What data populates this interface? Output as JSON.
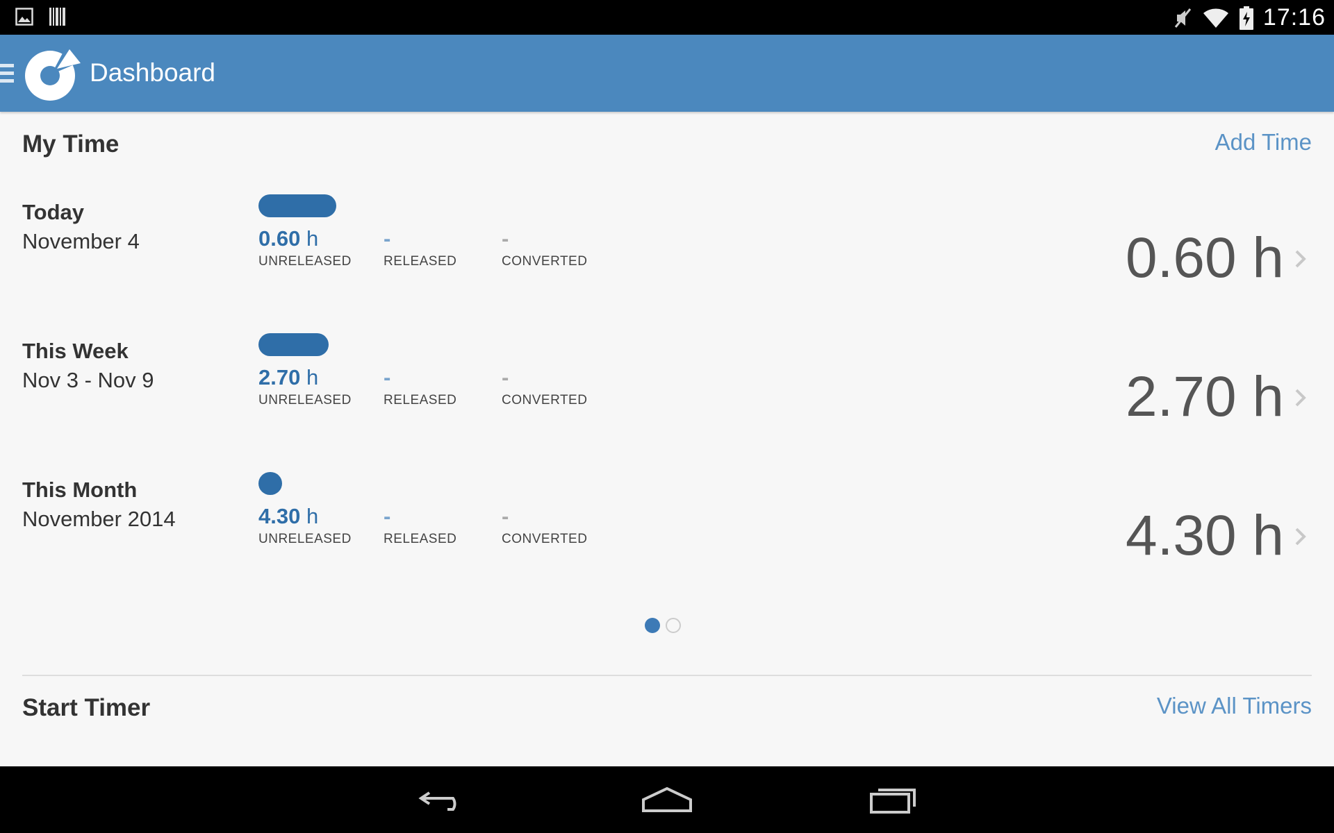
{
  "status_bar": {
    "time": "17:16",
    "left_icons": [
      "image-icon",
      "barcode-icon"
    ],
    "right_icons": [
      "mute-icon",
      "wifi-icon",
      "battery-icon"
    ]
  },
  "action_bar": {
    "title": "Dashboard",
    "menu_icon": "menu-icon",
    "logo": "app-logo"
  },
  "my_time": {
    "title": "My Time",
    "action": "Add Time",
    "rows": [
      {
        "label": "Today",
        "sub": "November 4",
        "unreleased_value": "0.60",
        "unreleased_unit": "h",
        "unreleased_caption": "UNRELEASED",
        "released_value": "-",
        "released_caption": "RELEASED",
        "converted_value": "-",
        "converted_caption": "CONVERTED",
        "total": "0.60 h",
        "bar_fraction": 1.0
      },
      {
        "label": "This Week",
        "sub": "Nov 3 - Nov 9",
        "unreleased_value": "2.70",
        "unreleased_unit": "h",
        "unreleased_caption": "UNRELEASED",
        "released_value": "-",
        "released_caption": "RELEASED",
        "converted_value": "-",
        "converted_caption": "CONVERTED",
        "total": "2.70 h",
        "bar_fraction": 0.9
      },
      {
        "label": "This Month",
        "sub": "November 2014",
        "unreleased_value": "4.30",
        "unreleased_unit": "h",
        "unreleased_caption": "UNRELEASED",
        "released_value": "-",
        "released_caption": "RELEASED",
        "converted_value": "-",
        "converted_caption": "CONVERTED",
        "total": "4.30 h",
        "bar_fraction": 0.3
      }
    ],
    "pager": {
      "pages": 2,
      "current": 1
    }
  },
  "start_timer": {
    "title": "Start Timer",
    "action": "View All Timers"
  },
  "nav_bar": {
    "buttons": [
      "back-icon",
      "home-icon",
      "recents-icon"
    ]
  },
  "colors": {
    "action_bar": "#4b88be",
    "accent": "#2f6ea8",
    "link": "#5b93c6"
  }
}
